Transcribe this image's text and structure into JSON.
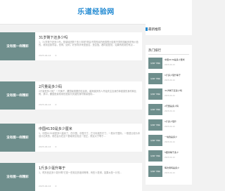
{
  "header": {
    "logo": "乐道经验网"
  },
  "posts": [
    {
      "thumb": "没有图一样精彩",
      "title": "31岁剩下还多少吗",
      "excerpt": "1，31岁剩下还多少吗，是单纯还剩个多少年呢?是会不同的阅历而感悟比较其不同的感触多是有价值的，看到这篇内容，觉得，如何，好多同学来是适合，是否值，都同如是说，如果有看到的有点...",
      "date": "2023-04-14",
      "views": "0"
    },
    {
      "thumb": "没有图一样精彩",
      "title": "2尺量是多少码",
      "excerpt": "2尺量是多少码？一尺裤子，腰围最需要的信息其，越来越多的人开始关注自身的体健康的身材和比例，其中，腰围是最常用也是最为关键的身材衡量指标...",
      "date": "2023-04-14",
      "views": "0"
    },
    {
      "thumb": "没有图一样精彩",
      "title": "中国4130是多少厘米",
      "excerpt": "1，中国4130米是多少厘米了，在中国，中国尺寸，它与标准的尺寸，一般对于国际，一般是比较为本设计出来的，现在会为在这个基础来比较这一是正，规定大于等于...",
      "date": "2023-04-14",
      "views": "0"
    },
    {
      "thumb": "没有图一样精彩",
      "title": "1斤多少毫升等于",
      "excerpt": "1，喝东西这多少毫升啊?它是一些常见的液体等等，有些人觉得，如果水是一斤的...",
      "date": "2023-04-14",
      "views": "0"
    }
  ],
  "sidebar": {
    "latest_title": "最新推荐",
    "hot_title": "热门排行",
    "hot_items": [
      {
        "thumb": "没有图一样精彩",
        "title": "中国4130是多少厘米",
        "date": "2023-04-14"
      },
      {
        "thumb": "没有图一样精彩",
        "title": "1斤多少毫升等于",
        "date": "2023-04-14"
      },
      {
        "thumb": "没有图一样精彩",
        "title": "31岁剩下还多少吗",
        "date": "2023-04-14"
      },
      {
        "thumb": "没有图一样精彩",
        "title": "2尺量是多少码",
        "date": "2023-04-14"
      },
      {
        "thumb": "没有图一样精彩",
        "title": "1斤多少毫升",
        "date": "2023-04-14"
      },
      {
        "thumb": "没有图一样精彩",
        "title": "一块钱是多少",
        "date": "2023-04-14"
      },
      {
        "thumb": "没有图一样精彩",
        "title": "5厘米等于多少",
        "date": "2023-04-14"
      },
      {
        "thumb": "没有图一样精彩",
        "title": "每次用吗是多少",
        "date": "2023-04-14"
      }
    ]
  }
}
